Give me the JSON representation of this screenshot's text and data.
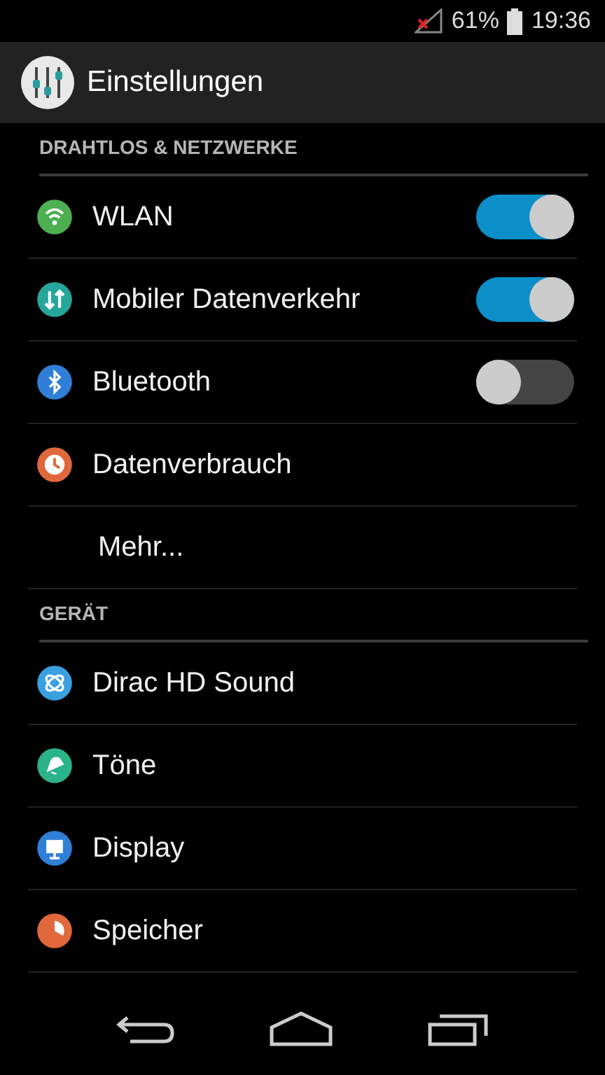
{
  "status_bar": {
    "battery": "61%",
    "time": "19:36"
  },
  "action_bar": {
    "title": "Einstellungen"
  },
  "sections": [
    {
      "header": "DRAHTLOS & NETZWERKE",
      "items": [
        {
          "kind": "toggle",
          "label": "WLAN",
          "on": true
        },
        {
          "kind": "toggle",
          "label": "Mobiler Datenverkehr",
          "on": true
        },
        {
          "kind": "toggle",
          "label": "Bluetooth",
          "on": false
        },
        {
          "kind": "plain",
          "label": "Datenverbrauch"
        },
        {
          "kind": "plain",
          "label": "Mehr..."
        }
      ]
    },
    {
      "header": "GERÄT",
      "items": [
        {
          "kind": "plain",
          "label": "Dirac HD Sound"
        },
        {
          "kind": "plain",
          "label": "Töne"
        },
        {
          "kind": "plain",
          "label": "Display"
        },
        {
          "kind": "plain",
          "label": "Speicher"
        }
      ]
    }
  ]
}
